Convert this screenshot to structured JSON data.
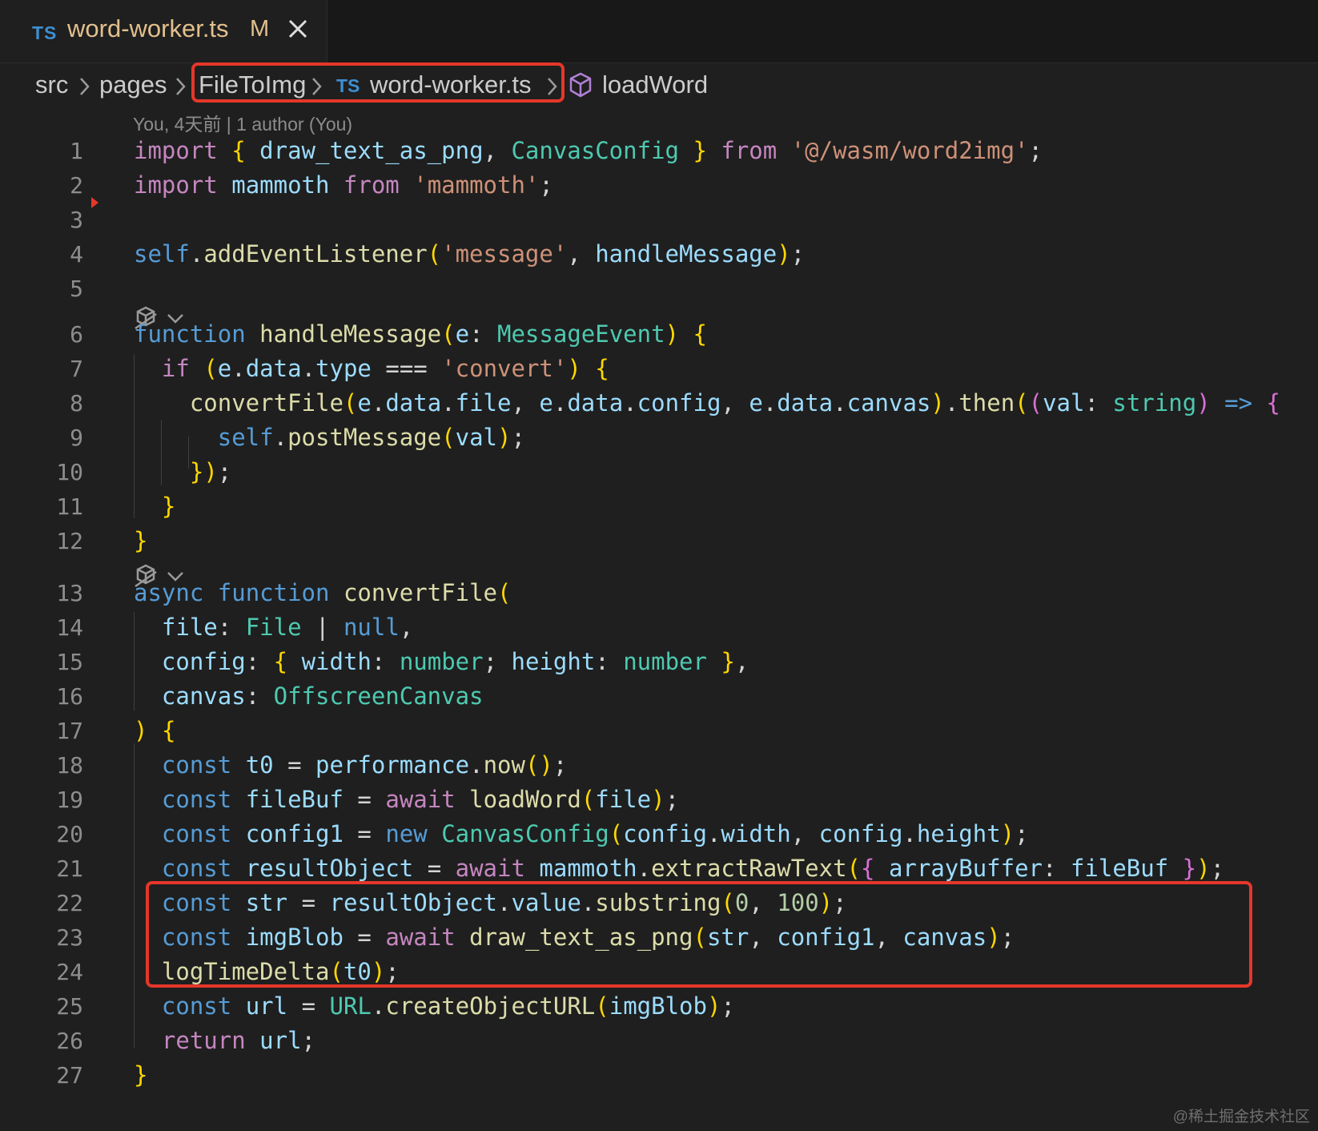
{
  "tab": {
    "lang_badge": "TS",
    "filename": "word-worker.ts",
    "modified": "M",
    "close_icon": "close-icon"
  },
  "breadcrumb": {
    "items": [
      "src",
      "pages",
      "FileToImg",
      "word-worker.ts",
      "loadWord"
    ],
    "file_badge": "TS",
    "separator_icon": "chevron-right-icon",
    "symbol_icon": "method-cube-icon"
  },
  "blame": "You, 4天前 | 1 author (You)",
  "lines": [
    {
      "n": "1",
      "code": "import { draw_text_as_png, CanvasConfig } from '@/wasm/word2img';"
    },
    {
      "n": "2",
      "code": "import mammoth from 'mammoth';"
    },
    {
      "n": "3",
      "code": ""
    },
    {
      "n": "4",
      "code": "self.addEventListener('message', handleMessage);"
    },
    {
      "n": "5",
      "code": ""
    },
    {
      "n": "6",
      "code": "function handleMessage(e: MessageEvent) {"
    },
    {
      "n": "7",
      "code": "  if (e.data.type === 'convert') {"
    },
    {
      "n": "8",
      "code": "    convertFile(e.data.file, e.data.config, e.data.canvas).then((val: string) => {"
    },
    {
      "n": "9",
      "code": "      self.postMessage(val);"
    },
    {
      "n": "10",
      "code": "    });"
    },
    {
      "n": "11",
      "code": "  }"
    },
    {
      "n": "12",
      "code": "}"
    },
    {
      "n": "13",
      "code": "async function convertFile("
    },
    {
      "n": "14",
      "code": "  file: File | null,"
    },
    {
      "n": "15",
      "code": "  config: { width: number; height: number },"
    },
    {
      "n": "16",
      "code": "  canvas: OffscreenCanvas"
    },
    {
      "n": "17",
      "code": ") {"
    },
    {
      "n": "18",
      "code": "  const t0 = performance.now();"
    },
    {
      "n": "19",
      "code": "  const fileBuf = await loadWord(file);"
    },
    {
      "n": "20",
      "code": "  const config1 = new CanvasConfig(config.width, config.height);"
    },
    {
      "n": "21",
      "code": "  const resultObject = await mammoth.extractRawText({ arrayBuffer: fileBuf });"
    },
    {
      "n": "22",
      "code": "  const str = resultObject.value.substring(0, 100);"
    },
    {
      "n": "23",
      "code": "  const imgBlob = await draw_text_as_png(str, config1, canvas);"
    },
    {
      "n": "24",
      "code": "  logTimeDelta(t0);"
    },
    {
      "n": "25",
      "code": "  const url = URL.createObjectURL(imgBlob);"
    },
    {
      "n": "26",
      "code": "  return url;"
    },
    {
      "n": "27",
      "code": "}"
    }
  ],
  "codelens_icon": "copilot-sparkle-icon",
  "fold_icon": "chevron-down-icon",
  "highlights": [
    {
      "target": "breadcrumb: FileToImg > word-worker.ts",
      "color": "#e5372a"
    },
    {
      "target": "lines 21-23",
      "color": "#e5372a"
    }
  ],
  "watermark": "@稀土掘金技术社区"
}
